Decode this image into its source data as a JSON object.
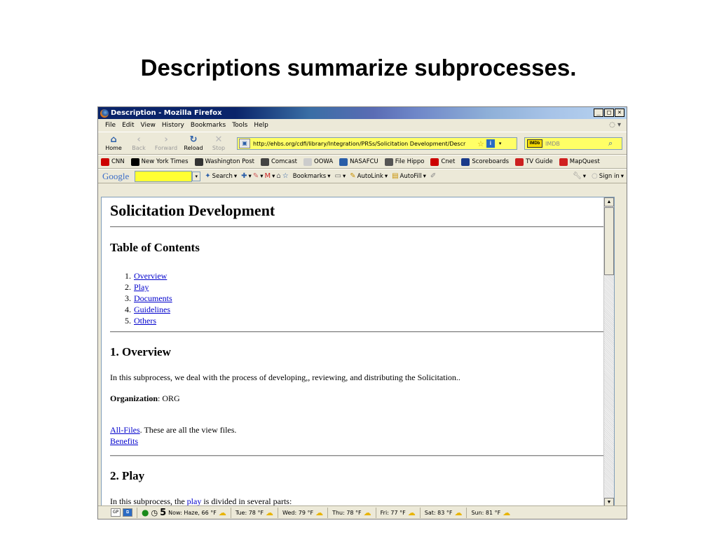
{
  "slide": {
    "title": "Descriptions summarize subprocesses."
  },
  "window": {
    "title": "Description - Mozilla Firefox",
    "controls": {
      "minimize": "_",
      "maximize": "□",
      "close": "×"
    }
  },
  "menu": {
    "items": [
      "File",
      "Edit",
      "View",
      "History",
      "Bookmarks",
      "Tools",
      "Help"
    ]
  },
  "nav": {
    "home": "Home",
    "back": "Back",
    "forward": "Forward",
    "reload": "Reload",
    "stop": "Stop",
    "url": "http://ehbs.org/cdfi/library/Integration/PRSs/Solicitation Development/Descr",
    "search_placeholder": "IMDB",
    "search_engine": "IMDb"
  },
  "bookmarks": [
    {
      "label": "CNN",
      "icon": "cnn-icon",
      "color": "#cc0000"
    },
    {
      "label": "New York Times",
      "icon": "nyt-icon",
      "color": "#000000"
    },
    {
      "label": "Washington Post",
      "icon": "wapo-icon",
      "color": "#333333"
    },
    {
      "label": "Comcast",
      "icon": "comcast-icon",
      "color": "#444444"
    },
    {
      "label": "OOWA",
      "icon": "page-icon",
      "color": "#cccccc"
    },
    {
      "label": "NASAFCU",
      "icon": "nasafcu-icon",
      "color": "#2a5ea8"
    },
    {
      "label": "File Hippo",
      "icon": "filehippo-icon",
      "color": "#555555"
    },
    {
      "label": "Cnet",
      "icon": "cnet-icon",
      "color": "#cc0000"
    },
    {
      "label": "Scoreboards",
      "icon": "si-icon",
      "color": "#1a3a8a"
    },
    {
      "label": "TV Guide",
      "icon": "tvguide-icon",
      "color": "#cc2020"
    },
    {
      "label": "MapQuest",
      "icon": "mapquest-icon",
      "color": "#d02020"
    }
  ],
  "google_toolbar": {
    "logo": "Google",
    "search": "Search",
    "bookmarks": "Bookmarks",
    "autolink": "AutoLink",
    "autofill": "AutoFill",
    "sign_in": "Sign in"
  },
  "page": {
    "title": "Solicitation Development",
    "toc_heading": "Table of Contents",
    "toc": [
      {
        "num": "1.",
        "label": "Overview"
      },
      {
        "num": "2.",
        "label": "Play"
      },
      {
        "num": "3.",
        "label": "Documents"
      },
      {
        "num": "4.",
        "label": "Guidelines"
      },
      {
        "num": "5.",
        "label": "Others"
      }
    ],
    "overview_heading": "1. Overview",
    "overview_text": "In this subprocess, we deal with the process of developing,, reviewing, and distributing the Solicitation..",
    "org_label": "Organization",
    "org_value": ": ORG",
    "all_files_link": "All-Files",
    "all_files_text": ". These are all the view files.",
    "benefits_link": "Benefits",
    "play_heading": "2. Play",
    "play_text_before": "In this subprocess, the ",
    "play_link": "play",
    "play_text_after": " is divided in several parts:"
  },
  "status": {
    "gp": "GP",
    "counter": "5",
    "now": "Now: Haze, 66 °F",
    "forecast": [
      "Tue: 78 °F",
      "Wed: 79 °F",
      "Thu: 78 °F",
      "Fri: 77 °F",
      "Sat: 83 °F",
      "Sun: 81 °F"
    ]
  }
}
